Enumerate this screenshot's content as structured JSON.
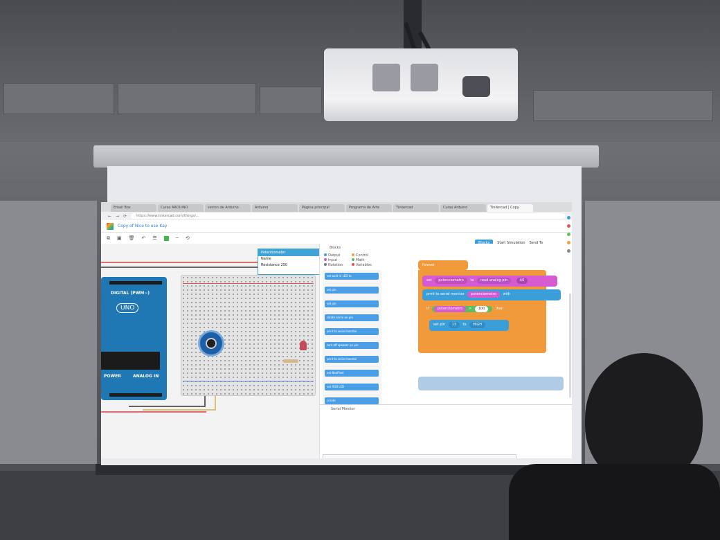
{
  "browser": {
    "tabs": [
      {
        "label": "Email Box"
      },
      {
        "label": "Curso ARDUINO"
      },
      {
        "label": "sesion de Arduino"
      },
      {
        "label": "Arduino"
      },
      {
        "label": "Página principal"
      },
      {
        "label": "Programa de Arte"
      },
      {
        "label": "Tinkercad"
      },
      {
        "label": "Curso Arduino"
      },
      {
        "label": "Tinkercad | Copy"
      }
    ],
    "url": "https://www.tinkercad.com/things/...",
    "nav": {
      "back": "←",
      "forward": "→",
      "reload": "⟳"
    }
  },
  "app": {
    "design_title": "Copy of Nice to use Kay",
    "toolbar_icons": [
      "copy-icon",
      "paste-icon",
      "delete-icon",
      "undo-icon",
      "notes-icon",
      "color-icon",
      "line-icon",
      "rotate-icon"
    ],
    "code_mode": "Blocks",
    "sim_label": "Start Simulation",
    "send_label": "Send To"
  },
  "component_panel": {
    "header": "Potentiometer",
    "name_label": "Name",
    "resistance_label": "Resistance",
    "resistance_value": "250"
  },
  "circuit": {
    "board_label_digital": "DIGITAL (PWM~)",
    "board_label_uno": "UNO",
    "board_label_power": "POWER",
    "board_label_analog": "ANALOG IN"
  },
  "code": {
    "palette_title": "Blocks",
    "categories": [
      {
        "label": "Output",
        "color": "#3b9ed8"
      },
      {
        "label": "Control",
        "color": "#f0a040"
      },
      {
        "label": "Input",
        "color": "#c75fd1"
      },
      {
        "label": "Math",
        "color": "#5cbf5c"
      },
      {
        "label": "Notation",
        "color": "#7a7a7a"
      },
      {
        "label": "Variables",
        "color": "#e0505a"
      }
    ],
    "palette_blocks": [
      "set built-in LED to",
      "set pin",
      "set pin",
      "rotate servo on pin",
      "print to serial monitor",
      "turn off speaker on pin",
      "print to serial monitor",
      "set NeoPixel",
      "set RGB LED",
      "create"
    ],
    "forever_label": "forever",
    "block_set": "set",
    "var_name": "potenciometro",
    "block_to": "to",
    "read_analog_label": "read analog pin",
    "analog_pin": "A0",
    "print_label": "print to serial monitor",
    "with_label": "with",
    "if_label": "if",
    "op": ">",
    "threshold": "100",
    "then_label": "then",
    "set_pin_label": "set pin",
    "pin_num": "13",
    "high_label": "HIGH",
    "serial_title": "Serial Monitor"
  },
  "colors": {
    "blocks_output": "#3b9ed8",
    "blocks_variable": "#d65bd1",
    "blocks_control": "#f09a3c",
    "blocks_math": "#5cbf5c"
  }
}
